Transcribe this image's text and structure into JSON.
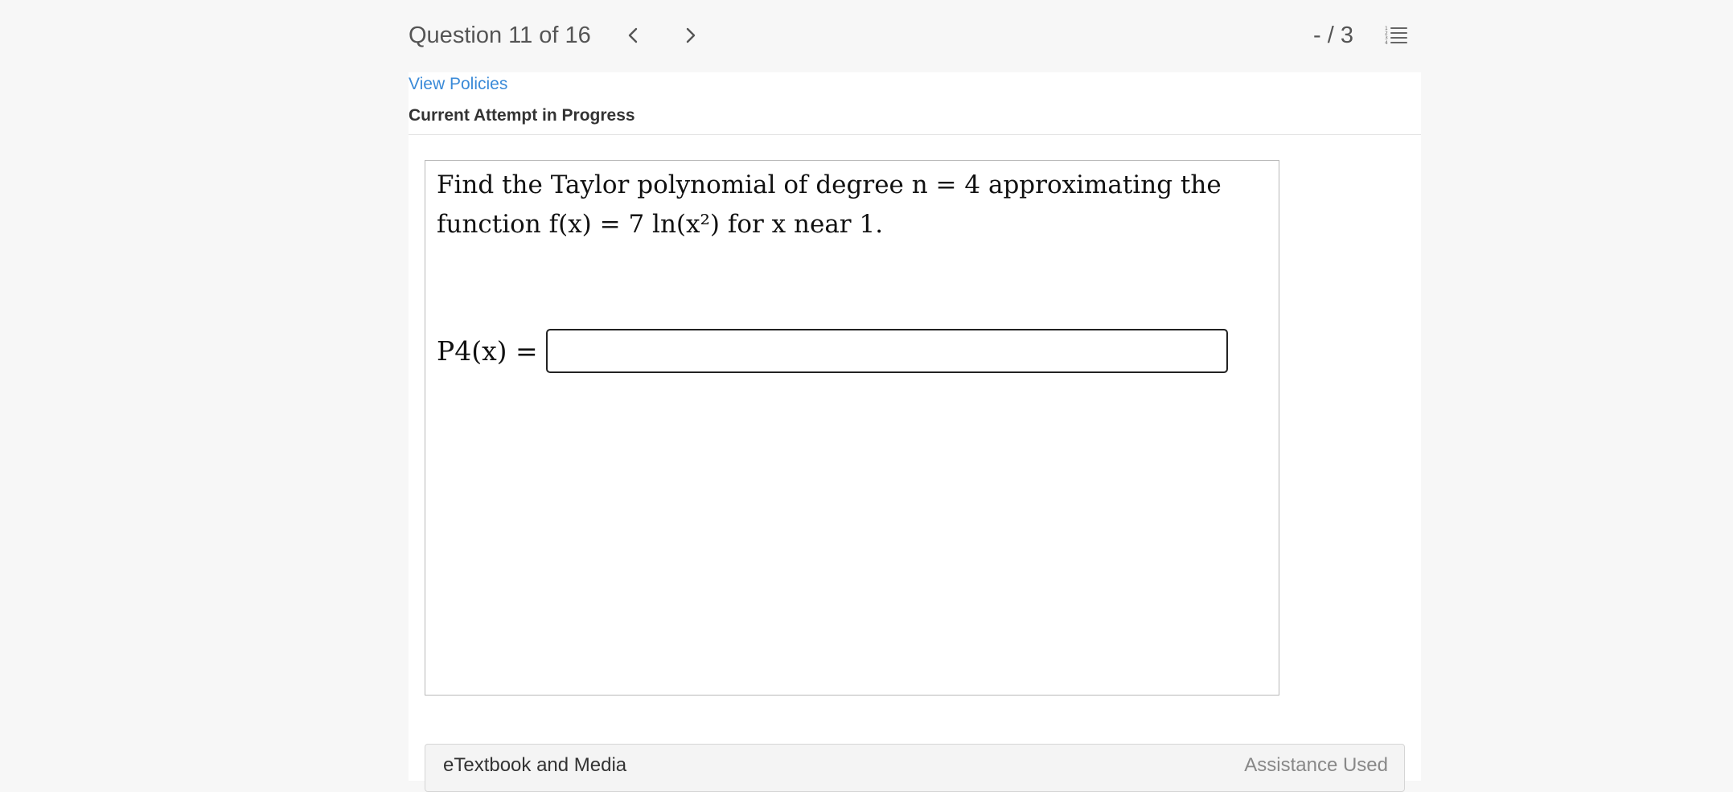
{
  "header": {
    "question_title": "Question 11 of 16",
    "prev_icon": "chevron-left-icon",
    "next_icon": "chevron-right-icon",
    "score": "- / 3",
    "list_icon": "numbered-list-icon"
  },
  "panel": {
    "view_policies": "View Policies",
    "attempt_status": "Current Attempt in Progress"
  },
  "question": {
    "prompt_line1": "Find the Taylor polynomial of degree n = 4 approximating the",
    "prompt_line2": "function f(x) = 7 ln(x²) for x near 1.",
    "answer_label": "P4(x) =",
    "answer_value": ""
  },
  "footer": {
    "etextbook_label": "eTextbook and Media",
    "assistance_label": "Assistance Used"
  },
  "colors": {
    "link": "#3a8ad8",
    "page_bg": "#f7f7f7",
    "panel_bg": "#ffffff"
  }
}
